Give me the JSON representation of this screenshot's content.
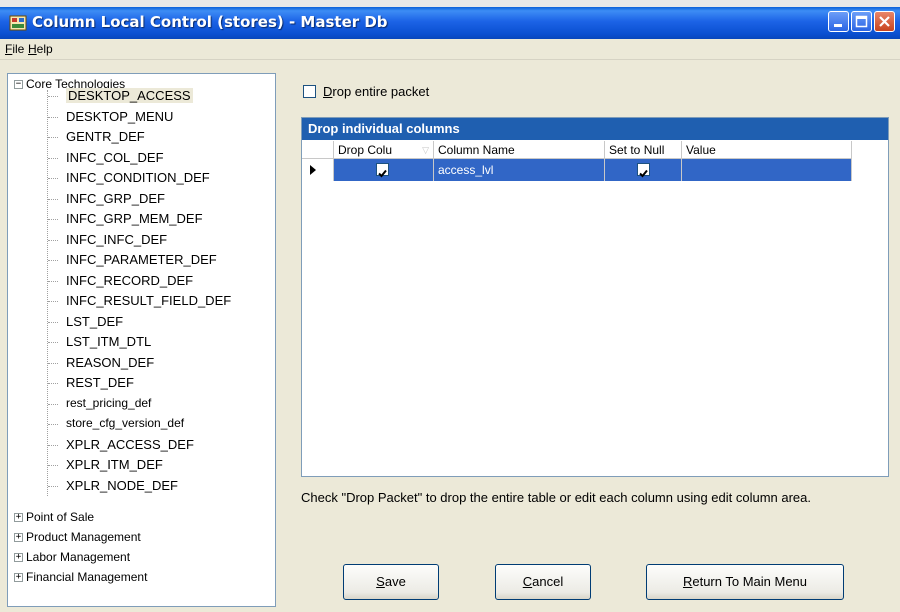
{
  "window": {
    "title": "Column Local Control (stores) - Master Db"
  },
  "menu": {
    "items": [
      {
        "label": "File",
        "mnemonic": "F",
        "rest": "ile"
      },
      {
        "label": "Help",
        "mnemonic": "H",
        "rest": "elp"
      }
    ]
  },
  "tree": {
    "root": {
      "label": "Core Technologies",
      "expanded": true
    },
    "children": [
      "DESKTOP_ACCESS",
      "DESKTOP_MENU",
      "GENTR_DEF",
      "INFC_COL_DEF",
      "INFC_CONDITION_DEF",
      "INFC_GRP_DEF",
      "INFC_GRP_MEM_DEF",
      "INFC_INFC_DEF",
      "INFC_PARAMETER_DEF",
      "INFC_RECORD_DEF",
      "INFC_RESULT_FIELD_DEF",
      "LST_DEF",
      "LST_ITM_DTL",
      "REASON_DEF",
      "REST_DEF",
      "rest_pricing_def",
      "store_cfg_version_def",
      "XPLR_ACCESS_DEF",
      "XPLR_ITM_DEF",
      "XPLR_NODE_DEF"
    ],
    "selected": "DESKTOP_ACCESS",
    "collapsed_groups": [
      "Point of Sale",
      "Product Management",
      "Labor Management",
      "Financial Management"
    ]
  },
  "drop_packet": {
    "label_mnemonic": "D",
    "label_rest": "rop entire packet",
    "checked": false
  },
  "grid": {
    "caption": "Drop individual columns",
    "columns": [
      "Drop Colu",
      "Column Name",
      "Set to Null",
      "Value"
    ],
    "rows": [
      {
        "drop_column": true,
        "column_name": "access_lvl",
        "set_to_null": true,
        "value": ""
      }
    ]
  },
  "info_text": "Check \"Drop Packet\" to drop the entire table or edit each column using edit column area.",
  "buttons": {
    "save": {
      "mnemonic": "S",
      "rest": "ave"
    },
    "cancel": {
      "mnemonic": "C",
      "rest": "ancel"
    },
    "return": {
      "mnemonic": "R",
      "rest": "eturn To Main Menu"
    }
  }
}
